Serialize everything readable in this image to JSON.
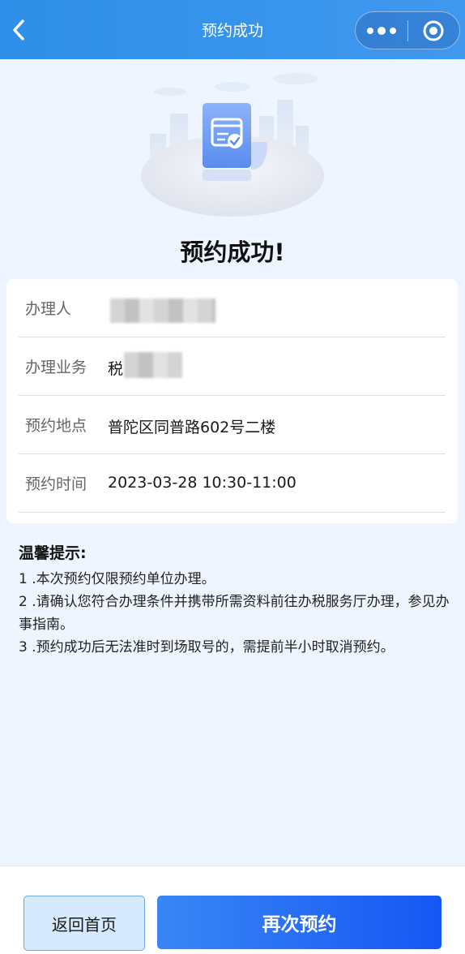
{
  "navbar": {
    "title": "预约成功",
    "back_icon": "chevron-left-icon",
    "more_icon": "more-dots-icon",
    "close_icon": "target-circle-icon",
    "color": "#3a93eb"
  },
  "result": {
    "title": "预约成功!",
    "illustration_icon": "calendar-check-icon"
  },
  "details": [
    {
      "label": "办理人",
      "value": ""
    },
    {
      "label": "办理业务",
      "value": "税"
    },
    {
      "label": "预约地点",
      "value": "普陀区同普路602号二楼"
    },
    {
      "label": "预约时间",
      "value": "2023-03-28 10:30-11:00"
    }
  ],
  "tips": {
    "title": "温馨提示:",
    "items": [
      "1 .本次预约仅限预约单位办理。",
      "2 .请确认您符合办理条件并携带所需资料前往办税服务厅办理，参见办事指南。",
      "3 .预约成功后无法准时到场取号的，需提前半小时取消预约。"
    ]
  },
  "actions": {
    "home_label": "返回首页",
    "again_label": "再次预约",
    "primary_color": "#1e63f5"
  }
}
